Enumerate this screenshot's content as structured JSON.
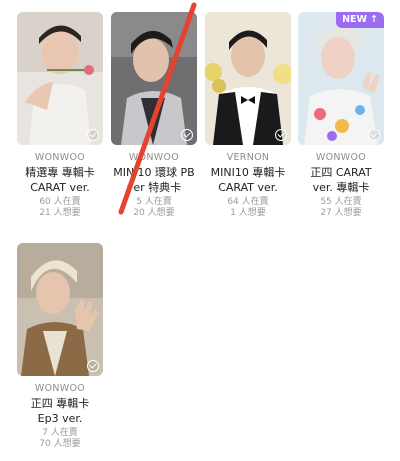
{
  "cards": [
    {
      "member": "WONWOO",
      "title_l1": "精選專 專輯卡",
      "title_l2": "CARAT ver.",
      "stat1": "60 人在賣",
      "stat2": "21 人想要"
    },
    {
      "member": "WONWOO",
      "title_l1": "MINI10 環球 PB",
      "title_l2": "ver 特典卡",
      "stat1": "5 人在賣",
      "stat2": "20 人想要"
    },
    {
      "member": "VERNON",
      "title_l1": "MINI10 專輯卡",
      "title_l2": "CARAT ver.",
      "stat1": "64 人在賣",
      "stat2": "1 人想要"
    },
    {
      "member": "WONWOO",
      "title_l1": "正四 CARAT",
      "title_l2": "ver. 專輯卡",
      "stat1": "55 人在賣",
      "stat2": "27 人想要",
      "badge": "NEW"
    },
    {
      "member": "WONWOO",
      "title_l1": "正四 專輯卡",
      "title_l2": "Ep3 ver.",
      "stat1": "7 人在賣",
      "stat2": "70 人想要"
    }
  ],
  "icons": {
    "badge_arrow": "arrow-up-icon",
    "owned": "check-circle-icon"
  },
  "colors": {
    "badge": "#9b6cf2",
    "strike": "#e5432f"
  }
}
